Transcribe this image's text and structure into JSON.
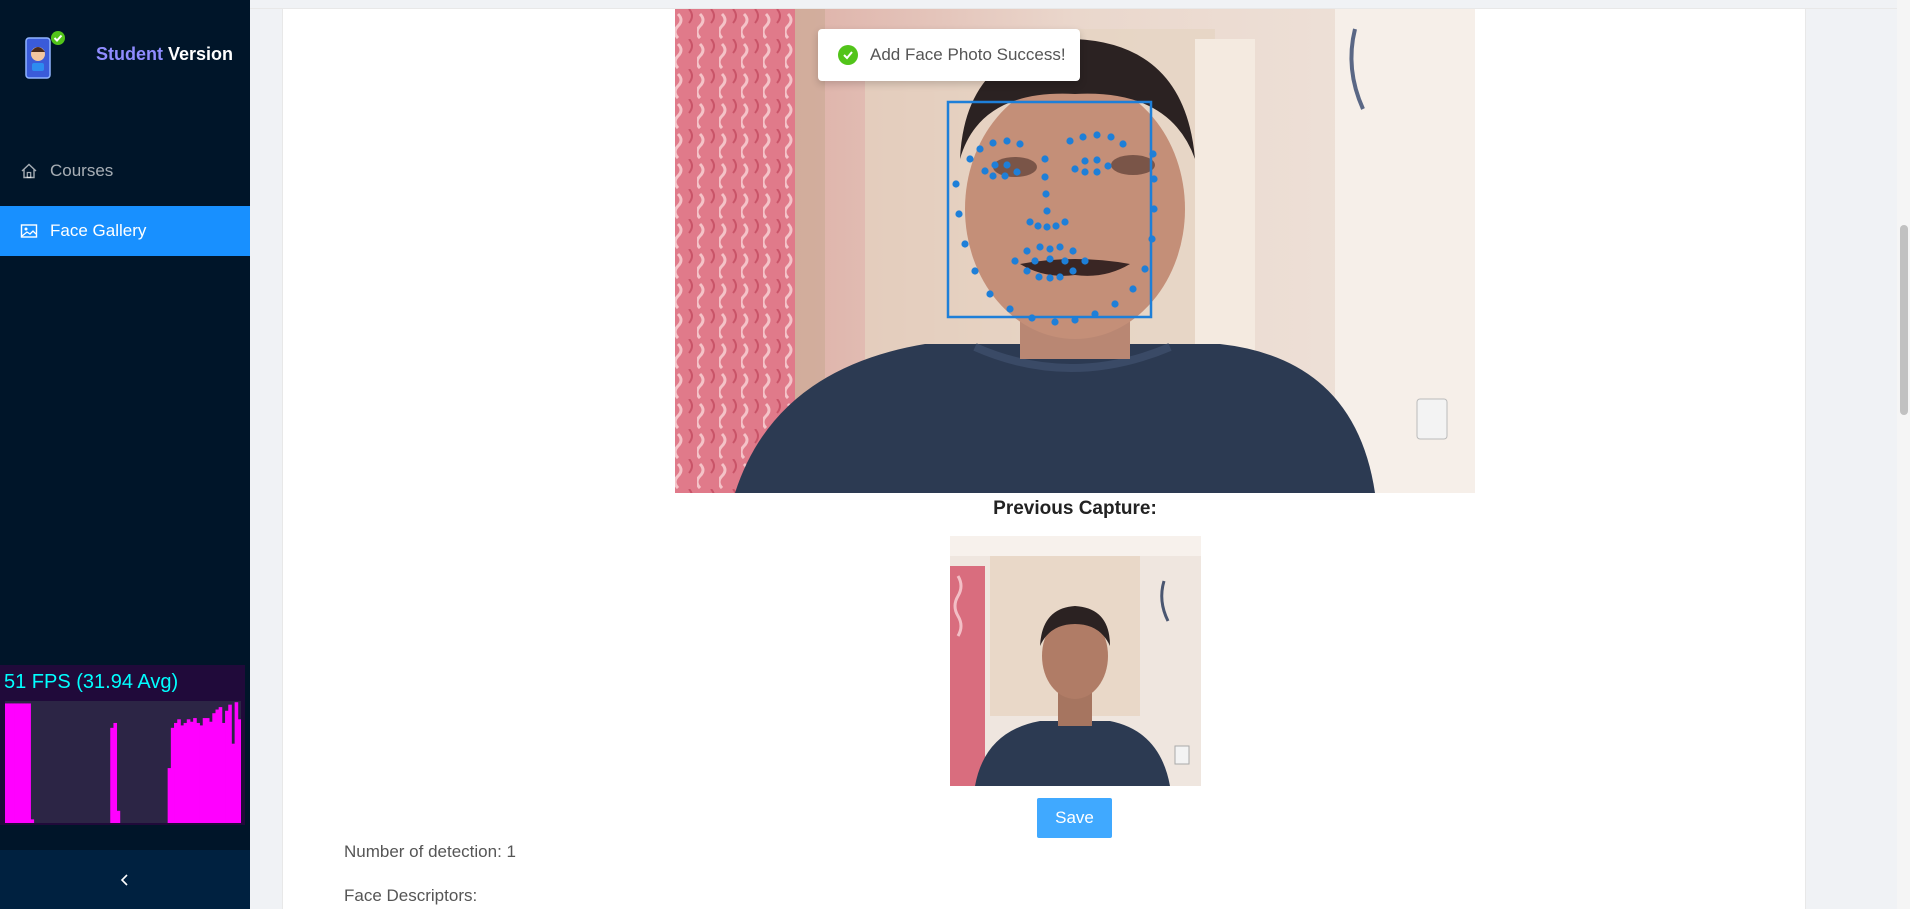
{
  "sidebar": {
    "brand_part1": "Student",
    "brand_part2": "Version",
    "items": [
      {
        "label": "Courses",
        "icon": "home-icon",
        "active": false
      },
      {
        "label": "Face Gallery",
        "icon": "picture-icon",
        "active": true
      }
    ],
    "collapse_icon": "chevron-left-icon"
  },
  "fps": {
    "label": "51 FPS (31.94 Avg)",
    "color": "#00ffff",
    "bar_color": "#ff00ff",
    "bars": [
      0.98,
      0.98,
      0.98,
      0.98,
      0.98,
      0.98,
      0.98,
      0.98,
      0.03,
      0,
      0,
      0,
      0,
      0,
      0,
      0,
      0,
      0,
      0,
      0,
      0,
      0,
      0,
      0.0,
      0,
      0,
      0,
      0,
      0,
      0,
      0,
      0,
      0,
      0.78,
      0.82,
      0.1,
      0,
      0,
      0,
      0,
      0,
      0,
      0,
      0,
      0,
      0,
      0,
      0,
      0,
      0,
      0,
      0.45,
      0.78,
      0.82,
      0.85,
      0.8,
      0.82,
      0.85,
      0.83,
      0.86,
      0.82,
      0.8,
      0.86,
      0.86,
      0.83,
      0.9,
      0.93,
      0.95,
      0.82,
      0.92,
      0.97,
      0.65,
      0.99,
      0.85
    ]
  },
  "toast": {
    "message": "Add Face Photo Success!",
    "icon": "check-circle-icon",
    "color": "#52c41a"
  },
  "main": {
    "previous_capture_title": "Previous Capture:",
    "save_label": "Save",
    "detections_label": "Number of detection: 1",
    "descriptors_label": "Face Descriptors:"
  },
  "colors": {
    "accent": "#1890ff",
    "sidebar_bg": "#001529",
    "landmark": "#1e7fd8"
  }
}
